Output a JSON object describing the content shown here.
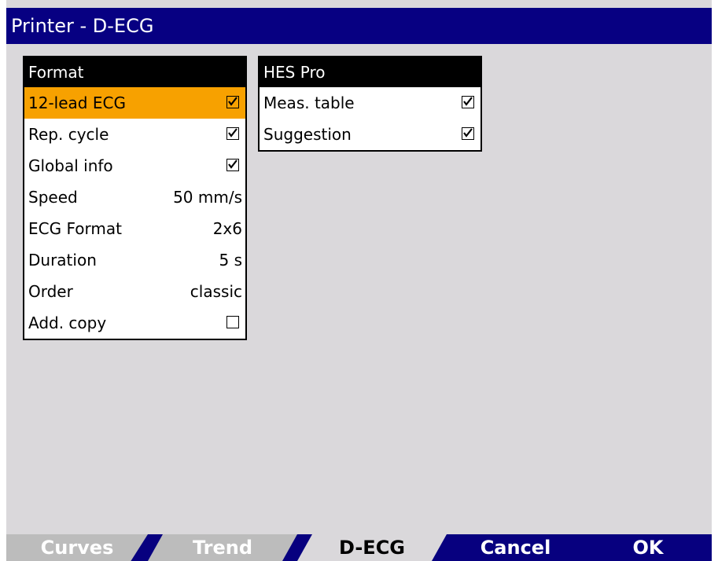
{
  "window": {
    "title": "Printer - D-ECG"
  },
  "format_panel": {
    "title": "Format",
    "rows": [
      {
        "label": "12-lead ECG",
        "checked": true,
        "selected": true
      },
      {
        "label": "Rep. cycle",
        "checked": true
      },
      {
        "label": "Global info",
        "checked": true
      },
      {
        "label": "Speed",
        "value": "50 mm/s"
      },
      {
        "label": "ECG Format",
        "value": "2x6"
      },
      {
        "label": "Duration",
        "value": "5 s"
      },
      {
        "label": "Order",
        "value": "classic"
      },
      {
        "label": "Add. copy",
        "checked": false
      }
    ]
  },
  "hes_panel": {
    "title": "HES Pro",
    "rows": [
      {
        "label": "Meas. table",
        "checked": true
      },
      {
        "label": "Suggestion",
        "checked": true
      }
    ]
  },
  "tabs": {
    "curves": "Curves",
    "trend": "Trend",
    "decg": "D-ECG",
    "cancel": "Cancel",
    "ok": "OK"
  },
  "colors": {
    "title_bar": "#070082",
    "selected_row": "#f7a100",
    "background": "#dad8db"
  }
}
